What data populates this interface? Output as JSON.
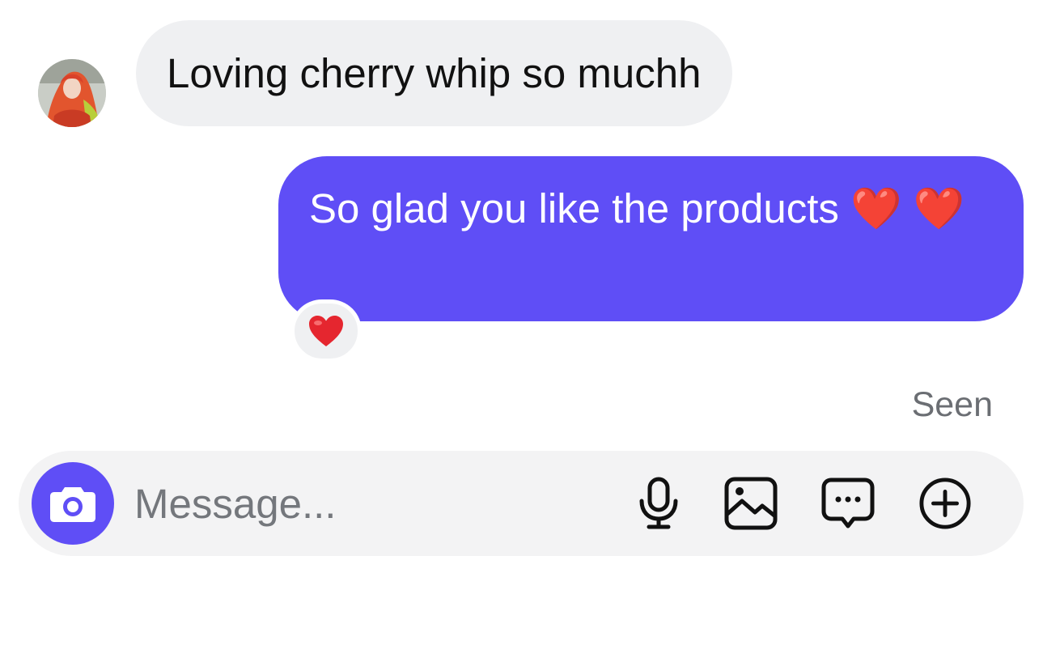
{
  "conversation": {
    "incoming": {
      "text": "Loving cherry whip so muchh",
      "avatar_icon": "profile-photo"
    },
    "outgoing": {
      "text": "So glad you like the products ❤️ ❤️",
      "reaction": "❤️"
    },
    "status": "Seen"
  },
  "composer": {
    "placeholder": "Message...",
    "camera_icon": "camera-icon",
    "tools": [
      "microphone-icon",
      "image-icon",
      "sticker-chat-icon",
      "plus-circle-icon"
    ]
  },
  "colors": {
    "accent": "#5f4ef6",
    "bubble_incoming": "#eff0f2",
    "composer_bg": "#f3f3f4",
    "muted_text": "#6b6e73",
    "heart": "#e5262f"
  }
}
